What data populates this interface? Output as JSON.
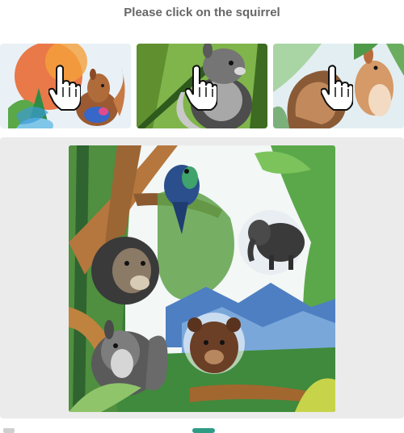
{
  "instruction": "Please click on the squirrel",
  "thumbnails": [
    {
      "name": "thumbnail-1",
      "subject": "squirrel",
      "cursor": "hand-pointer-icon"
    },
    {
      "name": "thumbnail-2",
      "subject": "squirrel",
      "cursor": "hand-pointer-icon"
    },
    {
      "name": "thumbnail-3",
      "subject": "squirrel",
      "cursor": "hand-pointer-icon"
    }
  ],
  "main_image": {
    "subjects": [
      "parrot",
      "elephant",
      "lion",
      "squirrel",
      "bear"
    ]
  },
  "colors": {
    "title": "#666666",
    "panel": "#ebebeb"
  }
}
